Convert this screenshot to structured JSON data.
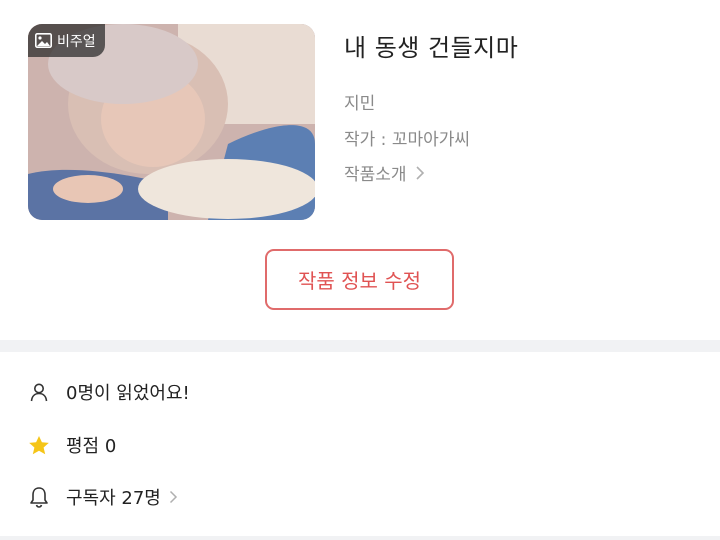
{
  "work": {
    "visual_badge": "비주얼",
    "title": "내 동생 건들지마",
    "author_name": "지민",
    "author_label": "작가 : 꼬마아가씨",
    "intro_label": "작품소개"
  },
  "actions": {
    "edit_label": "작품 정보 수정"
  },
  "stats": {
    "readers": "0명이 읽었어요!",
    "rating": "평점 0",
    "subscribers": "구독자 27명"
  },
  "colors": {
    "accent": "#e05353",
    "star": "#f5c518",
    "divider": "#f1f2f4"
  },
  "icons": {
    "badge": "image-icon",
    "readers": "person-icon",
    "rating": "star-icon",
    "subscribers": "bell-icon"
  }
}
